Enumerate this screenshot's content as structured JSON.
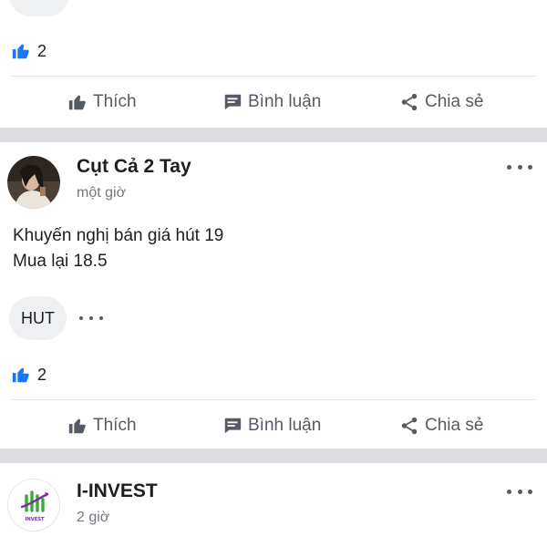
{
  "colors": {
    "accent": "#1877f2",
    "separator": "#dcdde1",
    "muted": "#72767d",
    "action": "#555b64"
  },
  "icons": {
    "like": "thumbs-up-icon",
    "comment": "comment-icon",
    "share": "share-icon",
    "more": "more-dots-icon"
  },
  "actions": {
    "like": "Thích",
    "comment": "Bình luận",
    "share": "Chia sẻ"
  },
  "posts": [
    {
      "likes": "2"
    },
    {
      "author": "Cụt Cả 2 Tay",
      "time": "một giờ",
      "text_lines": [
        "Khuyến nghị bán giá hút 19",
        "Mua lại 18.5"
      ],
      "tag": "HUT",
      "likes": "2"
    },
    {
      "author": "I-INVEST",
      "time": "2 giờ",
      "avatar_text": "INVEST"
    }
  ]
}
